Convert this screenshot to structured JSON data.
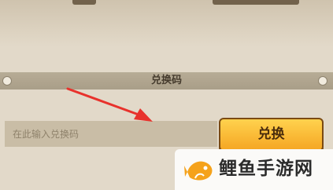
{
  "header": {
    "title": "兑换码"
  },
  "redeem_form": {
    "input_placeholder": "在此输入兑换码",
    "input_value": "",
    "button_label": "兑换"
  },
  "watermark": {
    "text": "鲤鱼手游网"
  },
  "colors": {
    "panel_background": "#e2d9c9",
    "header_bar": "#afa48e",
    "input_background": "#c9bda6",
    "button_gradient_top": "#ffd24e",
    "button_gradient_bottom": "#f5a623",
    "arrow": "#e8322c",
    "watermark_fish": "#f5a21b"
  },
  "icons": [
    "pin-icon",
    "arrow-pointer",
    "fish-logo-icon"
  ]
}
